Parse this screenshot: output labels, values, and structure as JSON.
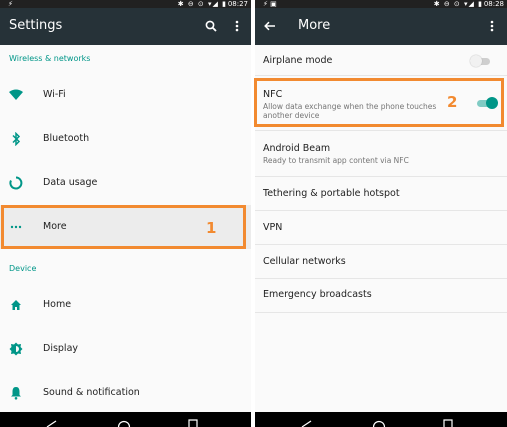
{
  "status_bar": {
    "left_time": "08:27",
    "right_time": "08:28"
  },
  "settings": {
    "title": "Settings",
    "sections": {
      "wireless": "Wireless & networks",
      "device": "Device"
    },
    "items": {
      "wifi": "Wi-Fi",
      "bluetooth": "Bluetooth",
      "data_usage": "Data usage",
      "more": "More",
      "home": "Home",
      "display": "Display",
      "sound": "Sound & notification"
    }
  },
  "more": {
    "title": "More",
    "airplane": {
      "title": "Airplane mode",
      "on": false
    },
    "nfc": {
      "title": "NFC",
      "subtitle": "Allow data exchange when the phone touches another device",
      "on": true
    },
    "android_beam": {
      "title": "Android Beam",
      "subtitle": "Ready to transmit app content via NFC"
    },
    "tethering": {
      "title": "Tethering & portable hotspot"
    },
    "vpn": {
      "title": "VPN"
    },
    "cellular": {
      "title": "Cellular networks"
    },
    "emergency": {
      "title": "Emergency broadcasts"
    }
  },
  "callouts": {
    "step1": "1",
    "step2": "2"
  },
  "colors": {
    "accent": "#009688",
    "app_bar": "#263238",
    "callout": "#f28a30"
  }
}
